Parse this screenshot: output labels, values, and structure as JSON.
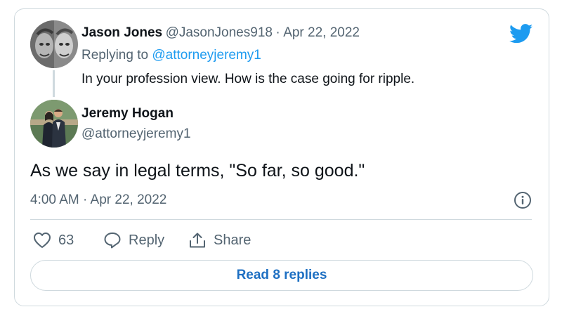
{
  "quoted_tweet": {
    "author_name": "Jason Jones",
    "author_handle": "@JasonJones918",
    "separator": "·",
    "date": "Apr 22, 2022",
    "replying_prefix": "Replying to",
    "replying_handle": "@attorneyjeremy1",
    "text": "In your profession view. How is the case going for ripple."
  },
  "main_tweet": {
    "author_name": "Jeremy Hogan",
    "author_handle": "@attorneyjeremy1",
    "text": "As we say in legal terms, \"So far, so good.\"",
    "timestamp": "4:00 AM · Apr 22, 2022"
  },
  "actions": {
    "like_count": "63",
    "reply_label": "Reply",
    "share_label": "Share"
  },
  "read_replies_label": "Read 8 replies",
  "icons": {
    "brand": "twitter-bird-icon",
    "like": "heart-icon",
    "reply": "speech-bubble-icon",
    "share": "share-upload-icon",
    "info": "info-icon"
  },
  "colors": {
    "brand_blue": "#1d9bf0",
    "link_blue": "#1d6fc2",
    "muted_text": "#536471",
    "border": "#cfd9de"
  }
}
